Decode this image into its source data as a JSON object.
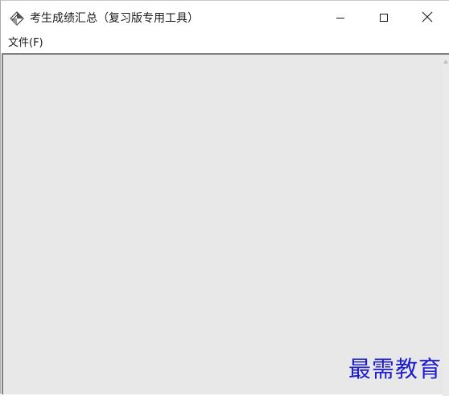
{
  "window": {
    "title": "考生成绩汇总（复习版专用工具）"
  },
  "menubar": {
    "items": [
      {
        "label": "文件(F)"
      }
    ]
  },
  "watermark": {
    "text": "最需教育",
    "color": "#1d1dcf"
  },
  "icons": {
    "app": "app-diamond-icon",
    "minimize": "minimize-icon",
    "maximize": "maximize-icon",
    "close": "close-icon"
  }
}
